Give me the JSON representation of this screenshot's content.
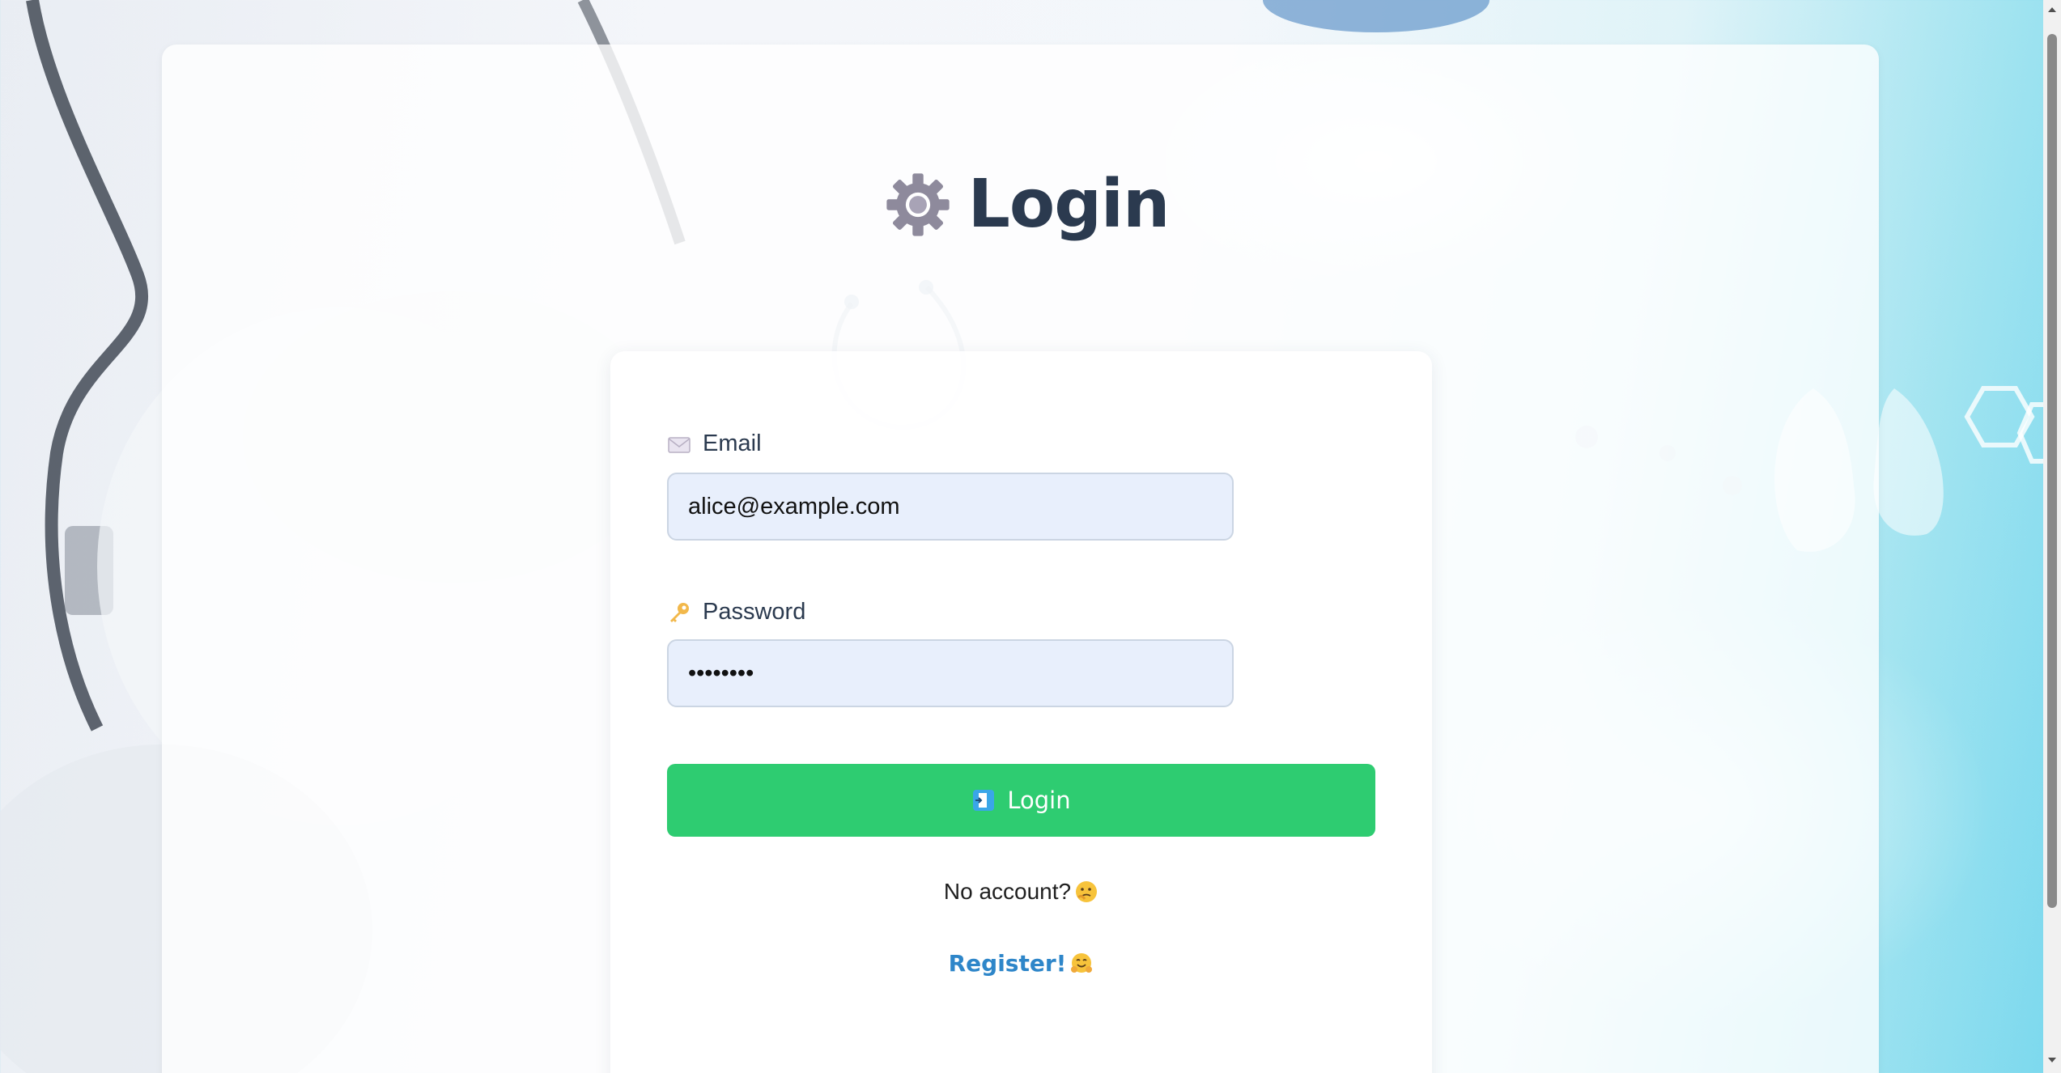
{
  "page": {
    "title": "Login"
  },
  "form": {
    "email_label": "Email",
    "email_value": "alice@example.com",
    "password_label": "Password",
    "password_value": "password",
    "login_button_label": "Login"
  },
  "footer": {
    "no_account_text": "No account?",
    "register_link_text": "Register!"
  },
  "icons": {
    "title": "gear-icon",
    "email": "envelope-icon",
    "password": "key-icon",
    "login_button": "login-door-icon",
    "no_account": "thinking-face-icon",
    "register": "hugging-face-icon"
  },
  "colors": {
    "primary_button": "#2ecc71",
    "title_text": "#2b3a4f",
    "link": "#2e86c9",
    "input_bg": "#e8effc"
  }
}
